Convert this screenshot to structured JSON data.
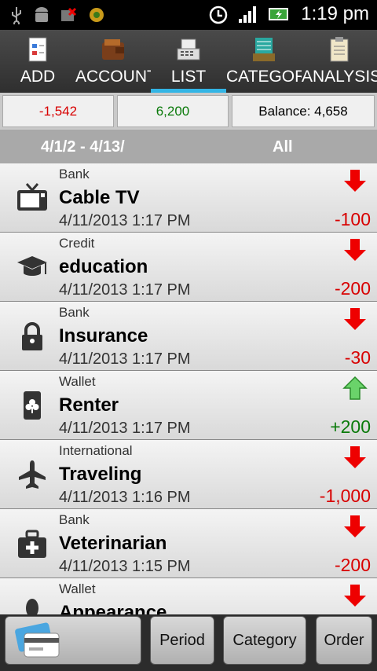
{
  "statusbar": {
    "time": "1:19 pm",
    "icons": [
      "usb-icon",
      "android-debug-icon",
      "sim-missing-icon",
      "settings-gear-icon",
      "alarm-icon",
      "signal-icon",
      "battery-charging-icon"
    ]
  },
  "tabs": [
    {
      "label": "ADD",
      "icon": "add-form-icon",
      "active": false
    },
    {
      "label": "ACCOUNT",
      "icon": "wallet-icon",
      "active": false
    },
    {
      "label": "LIST",
      "icon": "cash-register-icon",
      "active": true
    },
    {
      "label": "CATEGORY",
      "icon": "file-cabinet-icon",
      "active": false
    },
    {
      "label": "ANALYSIS",
      "icon": "clipboard-icon",
      "active": false
    }
  ],
  "summary": {
    "expense": "-1,542",
    "income": "6,200",
    "balance": "Balance: 4,658"
  },
  "period": {
    "range": "4/1/2 - 4/13/",
    "filter": "All"
  },
  "transactions": [
    {
      "account": "Bank",
      "name": "Cable TV",
      "date": "4/11/2013 1:17 PM",
      "amount": "-100",
      "direction": "down",
      "icon": "tv-icon"
    },
    {
      "account": "Credit",
      "name": "education",
      "date": "4/11/2013 1:17 PM",
      "amount": "-200",
      "direction": "down",
      "icon": "graduation-cap-icon"
    },
    {
      "account": "Bank",
      "name": "Insurance",
      "date": "4/11/2013 1:17 PM",
      "amount": "-30",
      "direction": "down",
      "icon": "lock-icon"
    },
    {
      "account": "Wallet",
      "name": "Renter",
      "date": "4/11/2013 1:17 PM",
      "amount": "+200",
      "direction": "up",
      "icon": "card-club-icon"
    },
    {
      "account": "International",
      "name": "Traveling",
      "date": "4/11/2013 1:16 PM",
      "amount": "-1,000",
      "direction": "down",
      "icon": "airplane-icon"
    },
    {
      "account": "Bank",
      "name": "Veterinarian",
      "date": "4/11/2013 1:15 PM",
      "amount": "-200",
      "direction": "down",
      "icon": "medical-kit-icon"
    },
    {
      "account": "Wallet",
      "name": "Appearance",
      "date": "",
      "amount": "",
      "direction": "down",
      "icon": "person-icon"
    }
  ],
  "bottom": {
    "period_label": "Period",
    "category_label": "Category",
    "order_label": "Order",
    "cards_icon": "credit-cards-icon"
  },
  "colors": {
    "expense": "#d80000",
    "income": "#0a7a0a",
    "accent": "#33b5e5"
  }
}
